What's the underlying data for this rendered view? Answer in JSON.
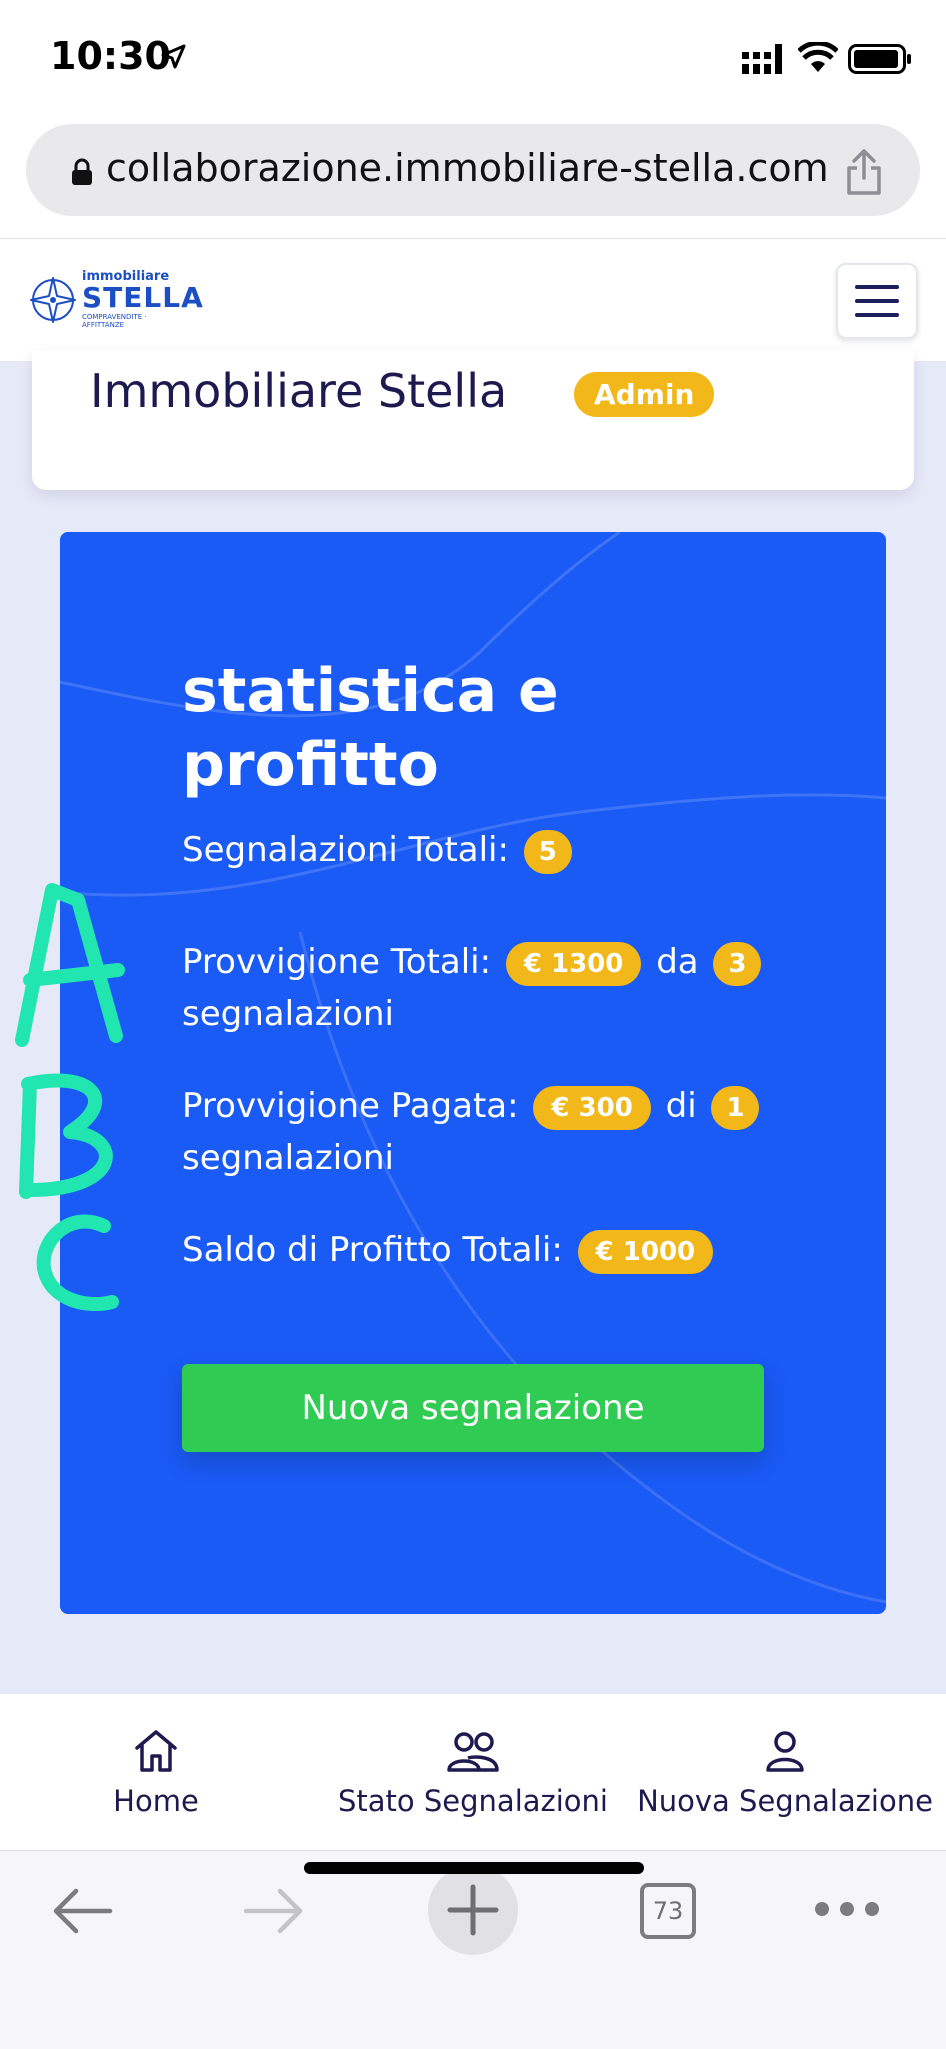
{
  "status_bar": {
    "time": "10:30",
    "icons": [
      "location-arrow-icon",
      "cellular-signal-icon",
      "wifi-icon",
      "battery-icon"
    ]
  },
  "browser": {
    "url": "collaborazione.immobiliare-stella.com",
    "tab_count": "73",
    "icons": [
      "lock-icon",
      "share-icon",
      "back-icon",
      "forward-icon",
      "new-tab-icon",
      "tabs-icon",
      "more-icon"
    ]
  },
  "site_header": {
    "logo": {
      "line1": "immobiliare",
      "line2": "STELLA",
      "tagline": "COMPRAVENDITE · AFFITTANZE"
    }
  },
  "profile": {
    "company_name": "Immobiliare Stella",
    "role_badge": "Admin"
  },
  "stats": {
    "title": "statistica e profitto",
    "segnalazioni_label": "Segnalazioni Totali:",
    "segnalazioni_count": "5",
    "provvigione_totali_label": "Provvigione Totali:",
    "provvigione_totali_amount": "€ 1300",
    "provvigione_totali_connector": "da",
    "provvigione_totali_count": "3",
    "provvigione_totali_suffix": "segnalazioni",
    "provvigione_pagata_label": "Provvigione Pagata:",
    "provvigione_pagata_amount": "€ 300",
    "provvigione_pagata_connector": "di",
    "provvigione_pagata_count": "1",
    "provvigione_pagata_suffix": "segnalazioni",
    "saldo_label": "Saldo di Profitto Totali:",
    "saldo_amount": "€ 1000",
    "new_button": "Nuova segnalazione"
  },
  "annotations": [
    "A",
    "B",
    "C"
  ],
  "bottom_nav": {
    "items": [
      {
        "label": "Home",
        "icon": "home-icon"
      },
      {
        "label": "Stato Segnalazioni",
        "icon": "users-icon"
      },
      {
        "label": "Nuova Segnalazione",
        "icon": "user-icon"
      }
    ]
  },
  "colors": {
    "brand_blue": "#1a5af5",
    "badge_yellow": "#f2b81a",
    "button_green": "#2fcb52",
    "text_navy": "#1d1a4f",
    "annotation_teal": "#22e6b0"
  }
}
